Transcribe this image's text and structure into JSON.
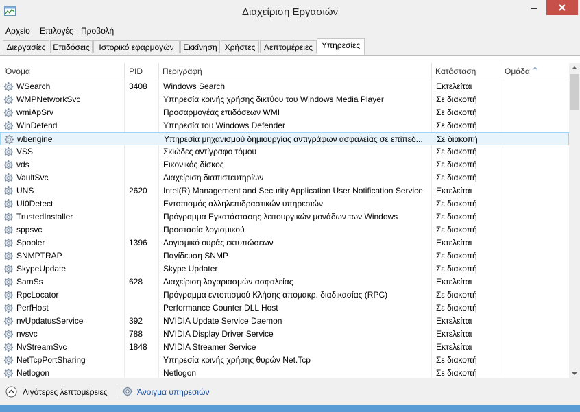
{
  "window": {
    "title": "Διαχείριση Εργασιών",
    "accent_color": "#c7504b",
    "frame_color": "#5b9bd5"
  },
  "menu": [
    {
      "label": "Αρχείο"
    },
    {
      "label": "Επιλογές"
    },
    {
      "label": "Προβολή"
    }
  ],
  "tabs": [
    {
      "label": "Διεργασίες"
    },
    {
      "label": "Επιδόσεις"
    },
    {
      "label": "Ιστορικό εφαρμογών"
    },
    {
      "label": "Εκκίνηση"
    },
    {
      "label": "Χρήστες"
    },
    {
      "label": "Λεπτομέρειες"
    },
    {
      "label": "Υπηρεσίες",
      "active": true
    }
  ],
  "table": {
    "columns": [
      "Όνομα",
      "PID",
      "Περιγραφή",
      "Κατάσταση",
      "Ομάδα"
    ],
    "sorted_column": "Όνομα",
    "sort_direction": "descending",
    "selected_row": "wbengine",
    "rows": [
      {
        "name": "WSearch",
        "pid": "3408",
        "desc": "Windows Search",
        "status": "Εκτελείται"
      },
      {
        "name": "WMPNetworkSvc",
        "pid": "",
        "desc": "Υπηρεσία κοινής χρήσης δικτύου του Windows Media Player",
        "status": "Σε διακοπή"
      },
      {
        "name": "wmiApSrv",
        "pid": "",
        "desc": "Προσαρμογέας επιδόσεων WMI",
        "status": "Σε διακοπή"
      },
      {
        "name": "WinDefend",
        "pid": "",
        "desc": "Υπηρεσία του Windows Defender",
        "status": "Σε διακοπή"
      },
      {
        "name": "wbengine",
        "pid": "",
        "desc": "Υπηρεσία μηχανισμού δημιουργίας αντιγράφων ασφαλείας σε επίπεδ...",
        "status": "Σε διακοπή"
      },
      {
        "name": "VSS",
        "pid": "",
        "desc": "Σκιώδες αντίγραφο τόμου",
        "status": "Σε διακοπή"
      },
      {
        "name": "vds",
        "pid": "",
        "desc": "Εικονικός δίσκος",
        "status": "Σε διακοπή"
      },
      {
        "name": "VaultSvc",
        "pid": "",
        "desc": "Διαχείριση διαπιστευτηρίων",
        "status": "Σε διακοπή"
      },
      {
        "name": "UNS",
        "pid": "2620",
        "desc": "Intel(R) Management and Security Application User Notification Service",
        "status": "Εκτελείται"
      },
      {
        "name": "UI0Detect",
        "pid": "",
        "desc": "Εντοπισμός αλληλεπιδραστικών υπηρεσιών",
        "status": "Σε διακοπή"
      },
      {
        "name": "TrustedInstaller",
        "pid": "",
        "desc": "Πρόγραμμα Εγκατάστασης λειτουργικών μονάδων των Windows",
        "status": "Σε διακοπή"
      },
      {
        "name": "sppsvc",
        "pid": "",
        "desc": "Προστασία λογισμικού",
        "status": "Σε διακοπή"
      },
      {
        "name": "Spooler",
        "pid": "1396",
        "desc": "Λογισμικό ουράς εκτυπώσεων",
        "status": "Εκτελείται"
      },
      {
        "name": "SNMPTRAP",
        "pid": "",
        "desc": "Παγίδευση SNMP",
        "status": "Σε διακοπή"
      },
      {
        "name": "SkypeUpdate",
        "pid": "",
        "desc": "Skype Updater",
        "status": "Σε διακοπή"
      },
      {
        "name": "SamSs",
        "pid": "628",
        "desc": "Διαχείριση λογαριασμών ασφαλείας",
        "status": "Εκτελείται"
      },
      {
        "name": "RpcLocator",
        "pid": "",
        "desc": "Πρόγραμμα εντοπισμού Κλήσης απομακρ. διαδικασίας (RPC)",
        "status": "Σε διακοπή"
      },
      {
        "name": "PerfHost",
        "pid": "",
        "desc": "Performance Counter DLL Host",
        "status": "Σε διακοπή"
      },
      {
        "name": "nvUpdatusService",
        "pid": "392",
        "desc": "NVIDIA Update Service Daemon",
        "status": "Εκτελείται"
      },
      {
        "name": "nvsvc",
        "pid": "788",
        "desc": "NVIDIA Display Driver Service",
        "status": "Εκτελείται"
      },
      {
        "name": "NvStreamSvc",
        "pid": "1848",
        "desc": "NVIDIA Streamer Service",
        "status": "Εκτελείται"
      },
      {
        "name": "NetTcpPortSharing",
        "pid": "",
        "desc": "Υπηρεσία κοινής χρήσης θυρών Net.Tcp",
        "status": "Σε διακοπή"
      },
      {
        "name": "Netlogon",
        "pid": "",
        "desc": "Netlogon",
        "status": "Σε διακοπή"
      }
    ]
  },
  "footer": {
    "fewer_details": "Λιγότερες λεπτομέρειες",
    "open_services": "Άνοιγμα υπηρεσιών"
  },
  "icons": {
    "app": "task-manager-icon",
    "service": "gear-icon",
    "fewer_details": "chevron-up-circle-icon",
    "open_services": "services-gear-icon"
  }
}
